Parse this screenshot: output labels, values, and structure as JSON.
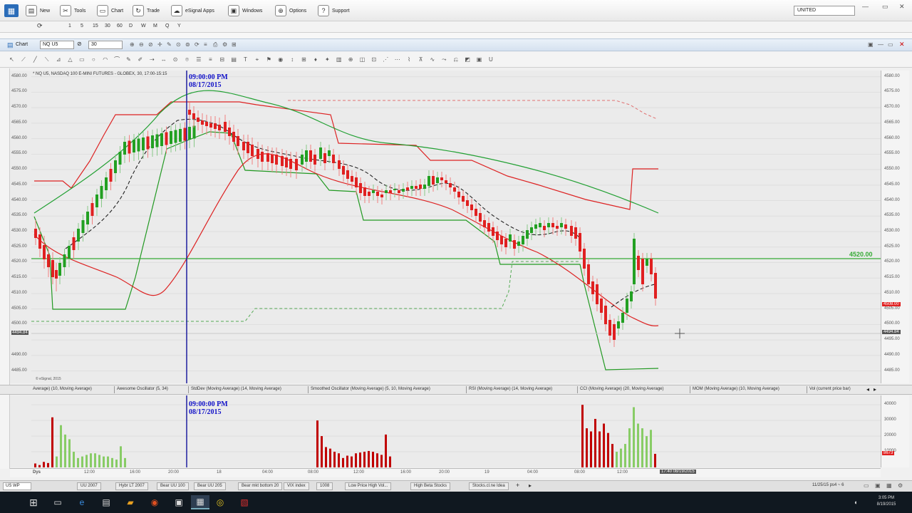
{
  "menu": {
    "items": [
      {
        "label": "New",
        "icon": "new-doc-icon",
        "glyph": "▤"
      },
      {
        "label": "Tools",
        "icon": "tools-icon",
        "glyph": "✂"
      },
      {
        "label": "Chart",
        "icon": "chart-icon",
        "glyph": "▭"
      },
      {
        "label": "Trade",
        "icon": "trade-icon",
        "glyph": "↻"
      },
      {
        "label": "eSignal Apps",
        "icon": "apps-icon",
        "glyph": "☁"
      },
      {
        "label": "Windows",
        "icon": "windows-icon",
        "glyph": "▣"
      },
      {
        "label": "Options",
        "icon": "options-icon",
        "glyph": "⊕"
      },
      {
        "label": "Support",
        "icon": "support-icon",
        "glyph": "?"
      }
    ],
    "symbol_combo": "UNITED"
  },
  "intervals": [
    "1",
    "5",
    "15",
    "30",
    "60",
    "D",
    "W",
    "M",
    "Q",
    "Y"
  ],
  "chart_window": {
    "title": "Chart",
    "symbol": "NQ U5",
    "interval": "30",
    "header": "* NQ U5, NASDAQ 100 E-MINI FUTURES - GLOBEX, 30, 17:00-15:15"
  },
  "cursor_label": {
    "time": "09:00:00 PM",
    "date": "08/17/2015"
  },
  "horizontal_line_label": "4520.00",
  "watermark": "© eSignal, 2015",
  "price_axis": [
    "4580.00",
    "4575.00",
    "4570.00",
    "4565.00",
    "4560.00",
    "4555.00",
    "4550.00",
    "4545.00",
    "4540.00",
    "4535.00",
    "4530.00",
    "4525.00",
    "4520.00",
    "4515.00",
    "4510.00",
    "4505.00",
    "4500.00",
    "4495.00",
    "4490.00",
    "4485.00"
  ],
  "price_axis_left": [
    "4580.00",
    "4575.00",
    "4570.00",
    "4565.00",
    "4560.00",
    "4555.00",
    "4550.00",
    "4545.00",
    "4540.00",
    "4535.00",
    "4530.00",
    "4525.00",
    "4520.00",
    "4515.00",
    "4510.00",
    "4505.00",
    "4500.00",
    "4494.84",
    "4490.00",
    "4485.00"
  ],
  "last_price_tag": "4508.00",
  "crosshair_price_tag": "4494.84",
  "volume_axis": [
    "40000",
    "30000",
    "20000",
    "10000"
  ],
  "volume_tag": "8673",
  "study_tabs": [
    "Average) (10, Moving Average)",
    "Awesome Oscillator (5, 34)",
    "StdDev (Moving Average) (14, Moving Average)",
    "Smoothed Oscillator (Moving Average) (5, 10, Moving Average)",
    "RSI (Moving Average) (14, Moving Average)",
    "CCI (Moving Average) (20, Moving Average)",
    "MOM (Moving Average) (10, Moving Average)",
    "Vol (current price bar)"
  ],
  "time_axis": {
    "start": "Dys",
    "labels": [
      "12:00",
      "16:00",
      "20:00",
      "18",
      "04:00",
      "08:00",
      "12:00",
      "16:00",
      "20:00",
      "19",
      "04:00",
      "08:00",
      "12:00"
    ],
    "cursor": "17:40 08/19/2015"
  },
  "page_tabs": [
    "US WP",
    "UU 2007",
    "Hybr LT 2007",
    "Bear UU 100",
    "Bear UU 205",
    "Bear mkt bottom 20",
    "VIX index",
    "1008",
    "Low Price High Vol...",
    "High Beta Stocks",
    "Stocks.cl.ne Idea"
  ],
  "status_right": "11/25/15 ps4 ~ 6",
  "clock": {
    "time": "3:05 PM",
    "date": "8/19/2015"
  },
  "colors": {
    "up": "#22a022",
    "down": "#e02020",
    "indicator_red": "#dd2222",
    "indicator_green": "#229922",
    "cursor_line": "#1e1ea0",
    "horizontal_line": "#33aa33",
    "vol_red": "#c00000",
    "vol_green": "#88cc66"
  }
}
